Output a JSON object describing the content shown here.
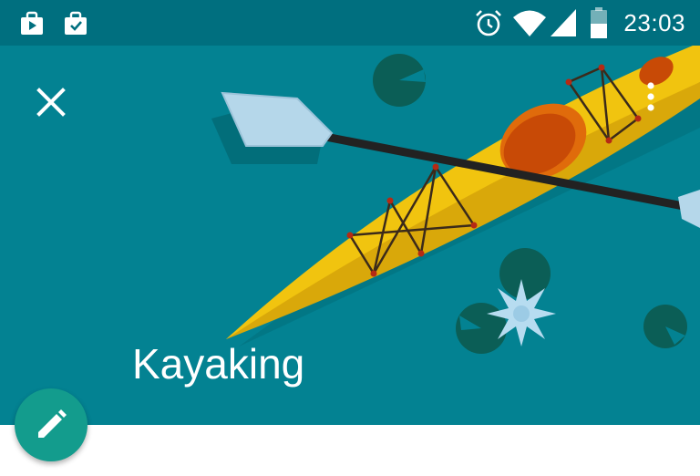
{
  "status_bar": {
    "time": "23:03",
    "left_icons": [
      "play-store-bag-icon",
      "briefcase-check-icon"
    ],
    "right_icons": [
      "alarm-clock-icon",
      "wifi-icon",
      "cell-signal-icon",
      "battery-icon"
    ]
  },
  "header": {
    "title": "Kayaking",
    "background_color": "#038292",
    "close_icon": "close-icon",
    "overflow_icon": "more-vertical-icon"
  },
  "fab": {
    "icon": "pencil-icon",
    "color": "#139c8d"
  }
}
